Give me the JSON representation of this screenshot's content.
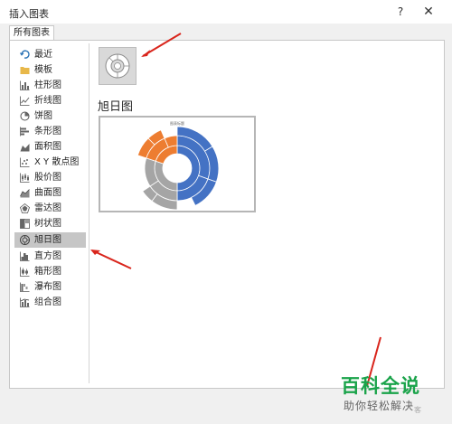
{
  "window": {
    "title": "插入图表",
    "help_glyph": "?",
    "close_glyph": "✕"
  },
  "tab": {
    "label": "所有图表"
  },
  "sidebar": {
    "items": [
      {
        "label": "最近",
        "icon": "recent-icon"
      },
      {
        "label": "模板",
        "icon": "template-folder-icon"
      },
      {
        "label": "柱形图",
        "icon": "column-chart-icon"
      },
      {
        "label": "折线图",
        "icon": "line-chart-icon"
      },
      {
        "label": "饼图",
        "icon": "pie-chart-icon"
      },
      {
        "label": "条形图",
        "icon": "bar-chart-icon"
      },
      {
        "label": "面积图",
        "icon": "area-chart-icon"
      },
      {
        "label": "X Y 散点图",
        "icon": "scatter-chart-icon"
      },
      {
        "label": "股价图",
        "icon": "stock-chart-icon"
      },
      {
        "label": "曲面图",
        "icon": "surface-chart-icon"
      },
      {
        "label": "雷达图",
        "icon": "radar-chart-icon"
      },
      {
        "label": "树状图",
        "icon": "treemap-chart-icon"
      },
      {
        "label": "旭日图",
        "icon": "sunburst-chart-icon"
      },
      {
        "label": "直方图",
        "icon": "histogram-chart-icon"
      },
      {
        "label": "箱形图",
        "icon": "box-whisker-chart-icon"
      },
      {
        "label": "瀑布图",
        "icon": "waterfall-chart-icon"
      },
      {
        "label": "组合图",
        "icon": "combo-chart-icon"
      }
    ],
    "selected": "旭日图"
  },
  "main": {
    "chart_type_title": "旭日图",
    "preview_title": "图表标题"
  },
  "colors": {
    "accent_blue": "#4472c4",
    "accent_orange": "#ed7d31",
    "accent_gray": "#a5a5a5",
    "arrow_red": "#d9251c",
    "watermark_green": "#1aa34a"
  },
  "watermark": {
    "main": "百科全说",
    "sub": "助你轻松解决",
    "extra": "客"
  }
}
